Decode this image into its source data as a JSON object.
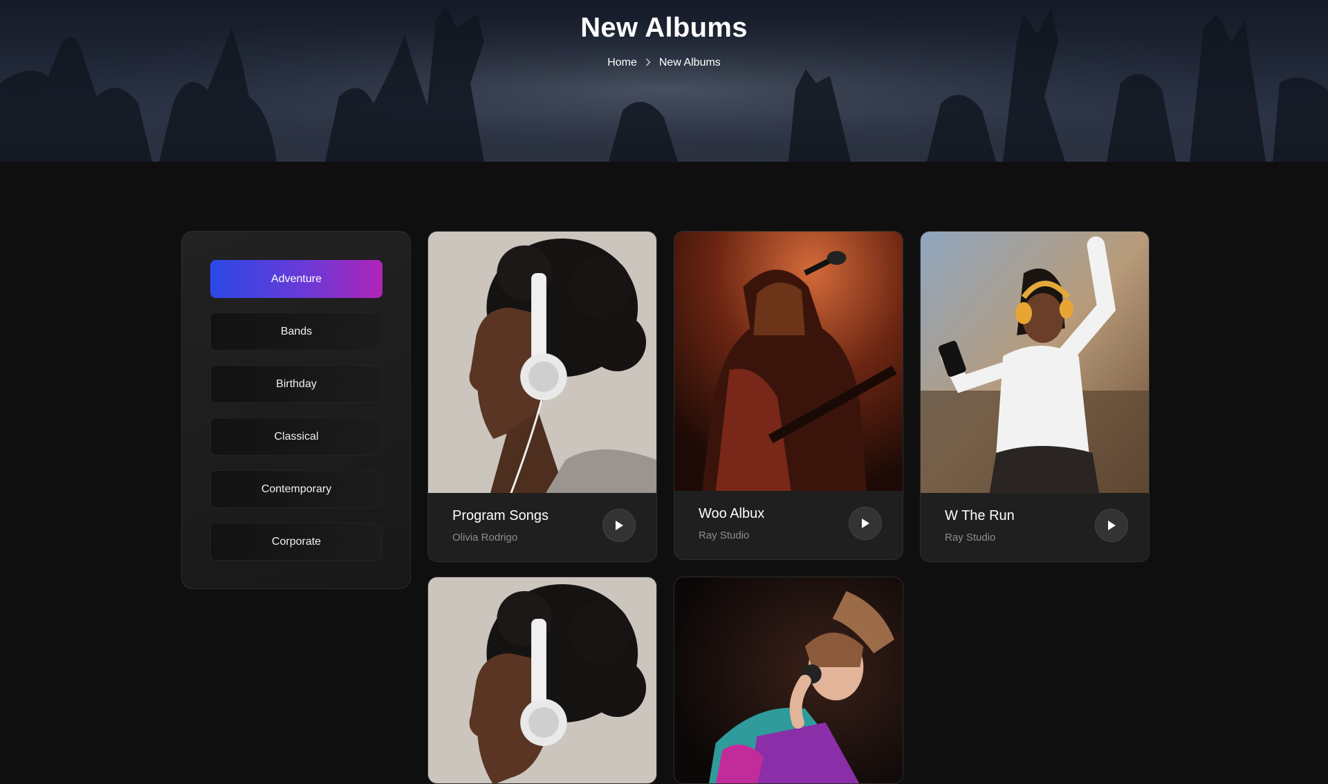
{
  "hero": {
    "title": "New Albums",
    "breadcrumb": {
      "home": "Home",
      "separator": "›",
      "current": "New Albums"
    }
  },
  "categories": [
    {
      "label": "Adventure",
      "active": true
    },
    {
      "label": "Bands",
      "active": false
    },
    {
      "label": "Birthday",
      "active": false
    },
    {
      "label": "Classical",
      "active": false
    },
    {
      "label": "Contemporary",
      "active": false
    },
    {
      "label": "Corporate",
      "active": false
    }
  ],
  "albums": [
    {
      "title": "Program Songs",
      "artist": "Olivia Rodrigo",
      "image": "woman-headphones-profile"
    },
    {
      "title": "Woo Albux",
      "artist": "Ray Studio",
      "image": "singer-guitar-red"
    },
    {
      "title": "W The Run",
      "artist": "Ray Studio",
      "image": "woman-dancing-yellow-headphones"
    },
    {
      "title": "",
      "artist": "",
      "image": "woman-headphones-profile"
    },
    {
      "title": "",
      "artist": "",
      "image": "woman-dancing-colorful"
    }
  ],
  "colors": {
    "background": "#0f0f0f",
    "card": "#1f1f1f",
    "accent_start": "#2b48e6",
    "accent_end": "#b024b8",
    "muted_text": "#8e8e8e"
  },
  "icons": {
    "play": "play-icon",
    "breadcrumb_separator": "chevron-right-icon"
  }
}
